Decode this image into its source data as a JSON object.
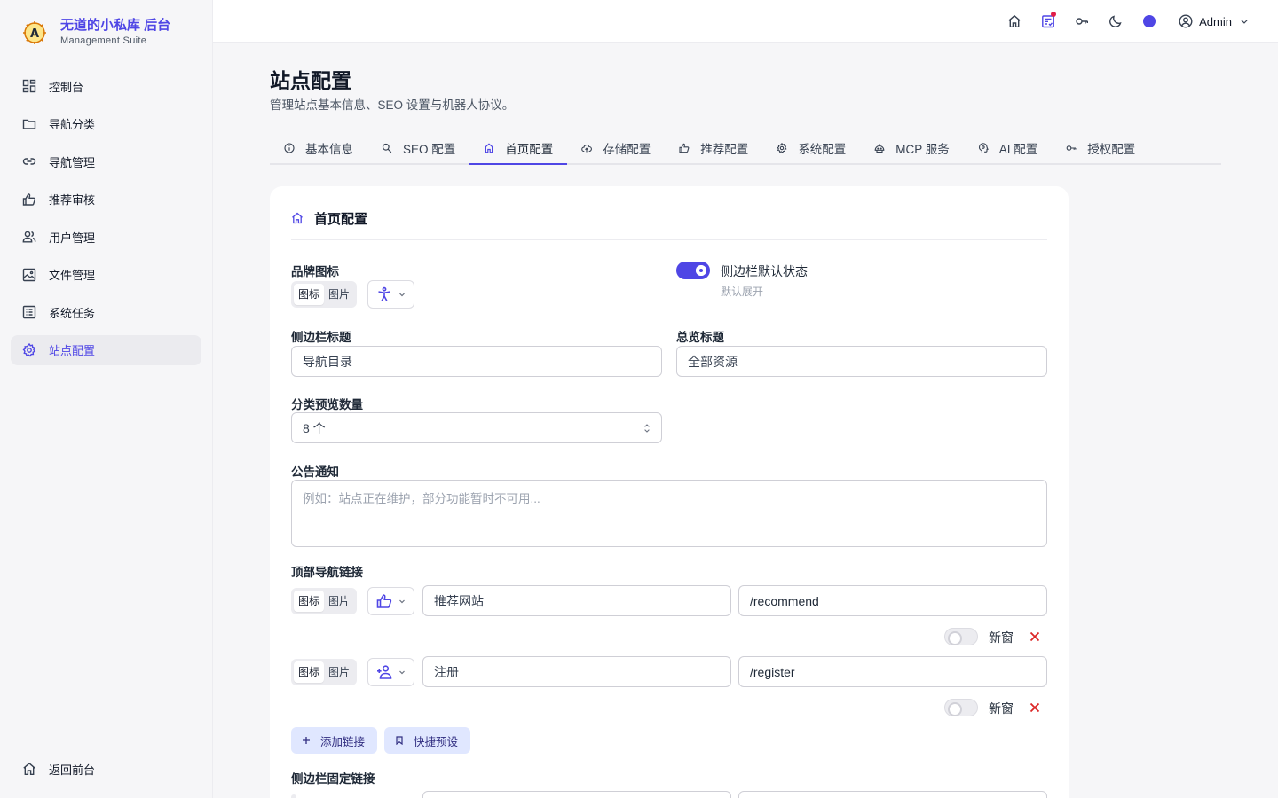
{
  "brand": {
    "title": "无道的小私库 后台",
    "subtitle": "Management Suite"
  },
  "sidebar": {
    "items": [
      {
        "label": "控制台",
        "icon": "dashboard-icon"
      },
      {
        "label": "导航分类",
        "icon": "folder-icon"
      },
      {
        "label": "导航管理",
        "icon": "link-icon"
      },
      {
        "label": "推荐审核",
        "icon": "thumbs-up-icon"
      },
      {
        "label": "用户管理",
        "icon": "users-icon"
      },
      {
        "label": "文件管理",
        "icon": "image-icon"
      },
      {
        "label": "系统任务",
        "icon": "task-list-icon"
      },
      {
        "label": "站点配置",
        "icon": "gear-icon",
        "active": true
      }
    ],
    "bottom": {
      "label": "返回前台",
      "icon": "home-icon"
    }
  },
  "topbar": {
    "user": "Admin"
  },
  "page": {
    "title": "站点配置",
    "description": "管理站点基本信息、SEO 设置与机器人协议。"
  },
  "tabs": [
    {
      "label": "基本信息",
      "icon": "info-icon"
    },
    {
      "label": "SEO 配置",
      "icon": "magnifier-icon"
    },
    {
      "label": "首页配置",
      "icon": "home-icon",
      "active": true
    },
    {
      "label": "存储配置",
      "icon": "cloud-upload-icon"
    },
    {
      "label": "推荐配置",
      "icon": "thumbs-up-icon"
    },
    {
      "label": "系统配置",
      "icon": "gear-icon"
    },
    {
      "label": "MCP 服务",
      "icon": "robot-icon"
    },
    {
      "label": "AI 配置",
      "icon": "brain-icon"
    },
    {
      "label": "授权配置",
      "icon": "key-icon"
    }
  ],
  "card": {
    "title": "首页配置",
    "brand_icon_label": "品牌图标",
    "seg_icon": "图标",
    "seg_image": "图片",
    "sidebar_default_label": "侧边栏默认状态",
    "sidebar_default_hint": "默认展开",
    "sidebar_title_label": "侧边栏标题",
    "sidebar_title_value": "导航目录",
    "overview_title_label": "总览标题",
    "overview_title_value": "全部资源",
    "preview_count_label": "分类预览数量",
    "preview_count_value": "8 个",
    "notice_label": "公告通知",
    "notice_placeholder": "例如：站点正在维护，部分功能暂时不可用...",
    "top_nav_label": "顶部导航链接",
    "links": [
      {
        "name": "推荐网站",
        "path": "/recommend",
        "icon": "thumbs-up-icon",
        "new_window_label": "新窗",
        "new_window": false
      },
      {
        "name": "注册",
        "path": "/register",
        "icon": "user-plus-icon",
        "new_window_label": "新窗",
        "new_window": false
      }
    ],
    "add_link": "添加链接",
    "quick_preset": "快捷预设",
    "sidebar_fixed_label": "侧边栏固定链接"
  },
  "colors": {
    "accent": "#4f46e5",
    "danger": "#dc2626"
  }
}
